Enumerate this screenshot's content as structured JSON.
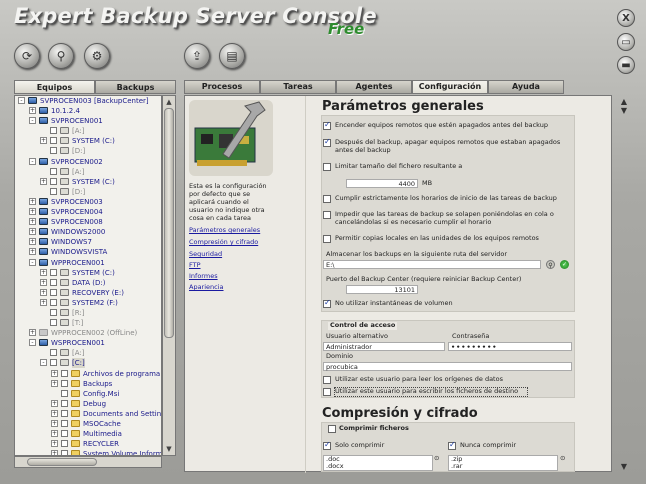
{
  "app": {
    "title": "Expert Backup Server Console",
    "edition": "Free"
  },
  "toolbar": {
    "icons": [
      "refresh-icon",
      "search-icon",
      "settings-icon",
      "export-icon",
      "save-icon"
    ]
  },
  "window": {
    "close": "X"
  },
  "left_tabs": [
    "Equipos",
    "Backups"
  ],
  "tree": [
    {
      "label": "SVPROCEN003 [BackupCenter]",
      "indent": 0,
      "exp": "-",
      "icon": "pc"
    },
    {
      "label": "10.1.2.4",
      "indent": 1,
      "exp": "+",
      "icon": "pc"
    },
    {
      "label": "SVPROCEN001",
      "indent": 1,
      "exp": "-",
      "icon": "pc"
    },
    {
      "label": "[A:]",
      "indent": 2,
      "exp": "",
      "icon": "drv",
      "ck": true,
      "grey": true
    },
    {
      "label": "SYSTEM (C:)",
      "indent": 2,
      "exp": "+",
      "icon": "drv",
      "ck": true
    },
    {
      "label": "[D:]",
      "indent": 2,
      "exp": "",
      "icon": "drv",
      "ck": true,
      "grey": true
    },
    {
      "label": "SVPROCEN002",
      "indent": 1,
      "exp": "-",
      "icon": "pc"
    },
    {
      "label": "[A:]",
      "indent": 2,
      "exp": "",
      "icon": "drv",
      "ck": true,
      "grey": true
    },
    {
      "label": "SYSTEM (C:)",
      "indent": 2,
      "exp": "+",
      "icon": "drv",
      "ck": true
    },
    {
      "label": "[D:]",
      "indent": 2,
      "exp": "",
      "icon": "drv",
      "ck": true,
      "grey": true
    },
    {
      "label": "SVPROCEN003",
      "indent": 1,
      "exp": "+",
      "icon": "pc"
    },
    {
      "label": "SVPROCEN004",
      "indent": 1,
      "exp": "+",
      "icon": "pc"
    },
    {
      "label": "SVPROCEN008",
      "indent": 1,
      "exp": "+",
      "icon": "pc"
    },
    {
      "label": "WINDOWS2000",
      "indent": 1,
      "exp": "+",
      "icon": "pc"
    },
    {
      "label": "WINDOWS7",
      "indent": 1,
      "exp": "+",
      "icon": "pc"
    },
    {
      "label": "WINDOWSVISTA",
      "indent": 1,
      "exp": "+",
      "icon": "pc"
    },
    {
      "label": "WPPROCEN001",
      "indent": 1,
      "exp": "-",
      "icon": "pc"
    },
    {
      "label": "SYSTEM (C:)",
      "indent": 2,
      "exp": "+",
      "icon": "drv",
      "ck": true
    },
    {
      "label": "DATA (D:)",
      "indent": 2,
      "exp": "+",
      "icon": "drv",
      "ck": true
    },
    {
      "label": "RECOVERY (E:)",
      "indent": 2,
      "exp": "+",
      "icon": "drv",
      "ck": true
    },
    {
      "label": "SYSTEM2 (F:)",
      "indent": 2,
      "exp": "+",
      "icon": "drv",
      "ck": true
    },
    {
      "label": "[R:]",
      "indent": 2,
      "exp": "",
      "icon": "drv",
      "ck": true,
      "grey": true
    },
    {
      "label": "[T:]",
      "indent": 2,
      "exp": "",
      "icon": "drv",
      "ck": true,
      "grey": true
    },
    {
      "label": "WPPROCEN002 (OffLine)",
      "indent": 1,
      "exp": "+",
      "icon": "off",
      "grey": true
    },
    {
      "label": "WSPROCEN001",
      "indent": 1,
      "exp": "-",
      "icon": "pc"
    },
    {
      "label": "[A:]",
      "indent": 2,
      "exp": "",
      "icon": "drv",
      "ck": true,
      "grey": true
    },
    {
      "label": "[C:]",
      "indent": 2,
      "exp": "-",
      "icon": "drv",
      "ck": true,
      "sel": true
    },
    {
      "label": "Archivos de programa",
      "indent": 3,
      "exp": "+",
      "icon": "fld",
      "ck": true
    },
    {
      "label": "Backups",
      "indent": 3,
      "exp": "+",
      "icon": "fld",
      "ck": true
    },
    {
      "label": "Config.Msi",
      "indent": 3,
      "exp": "",
      "icon": "fld",
      "ck": true
    },
    {
      "label": "Debug",
      "indent": 3,
      "exp": "+",
      "icon": "fld",
      "ck": true
    },
    {
      "label": "Documents and Settings",
      "indent": 3,
      "exp": "+",
      "icon": "fld",
      "ck": true
    },
    {
      "label": "MSOCache",
      "indent": 3,
      "exp": "+",
      "icon": "fld",
      "ck": true
    },
    {
      "label": "Multimedia",
      "indent": 3,
      "exp": "+",
      "icon": "fld",
      "ck": true
    },
    {
      "label": "RECYCLER",
      "indent": 3,
      "exp": "+",
      "icon": "fld",
      "ck": true
    },
    {
      "label": "System Volume Informatic",
      "indent": 3,
      "exp": "+",
      "icon": "fld",
      "ck": true
    }
  ],
  "main_tabs": [
    "Procesos",
    "Tareas",
    "Agentes",
    "Configuración",
    "Ayuda"
  ],
  "side": {
    "description": "Esta es la configuración por defecto que se aplicará cuando el usuario no indique otra cosa en cada tarea",
    "links": [
      "Parámetros generales",
      "Compresión y cifrado",
      "Seguridad",
      "FTP",
      "Informes",
      "Apariencia"
    ]
  },
  "general": {
    "heading": "Parámetros generales",
    "opt1": "Encender equipos remotos que estén apagados antes del backup",
    "opt2": "Después del backup, apagar equipos remotos que estaban apagados antes del backup",
    "opt3": "Limitar tamaño del fichero resultante a",
    "size_value": "4400",
    "size_unit": "MB",
    "opt4": "Cumplir estrictamente los horarios de inicio de las tareas de backup",
    "opt5": "Impedir que las tareas de backup se solapen poniéndolas en cola o cancelándolas si es necesario cumplir el horario",
    "opt6": "Permitir copias locales en las unidades de los equipos remotos",
    "path_label": "Almacenar los backups en la siguiente ruta del servidor",
    "path_value": "E:\\",
    "port_label": "Puerto del Backup Center (requiere reiniciar Backup Center)",
    "port_value": "13101",
    "opt7": "No utilizar instantáneas de volumen"
  },
  "access": {
    "title": "Control de acceso",
    "user_label": "Usuario alternativo",
    "pass_label": "Contraseña",
    "user_value": "Administrador",
    "pass_value": "•••••••••",
    "domain_label": "Dominio",
    "domain_value": "procubica",
    "opt_read": "Utilizar este usuario para leer los orígenes de datos",
    "opt_write": "Utilizar este usuario para escribir los ficheros de destino"
  },
  "compression": {
    "heading": "Compresión y cifrado",
    "title": "Comprimir ficheros",
    "only_label": "Solo comprimir",
    "never_label": "Nunca comprimir",
    "only_list": [
      ".doc",
      ".docx"
    ],
    "never_list": [
      ".zip",
      ".rar"
    ]
  }
}
